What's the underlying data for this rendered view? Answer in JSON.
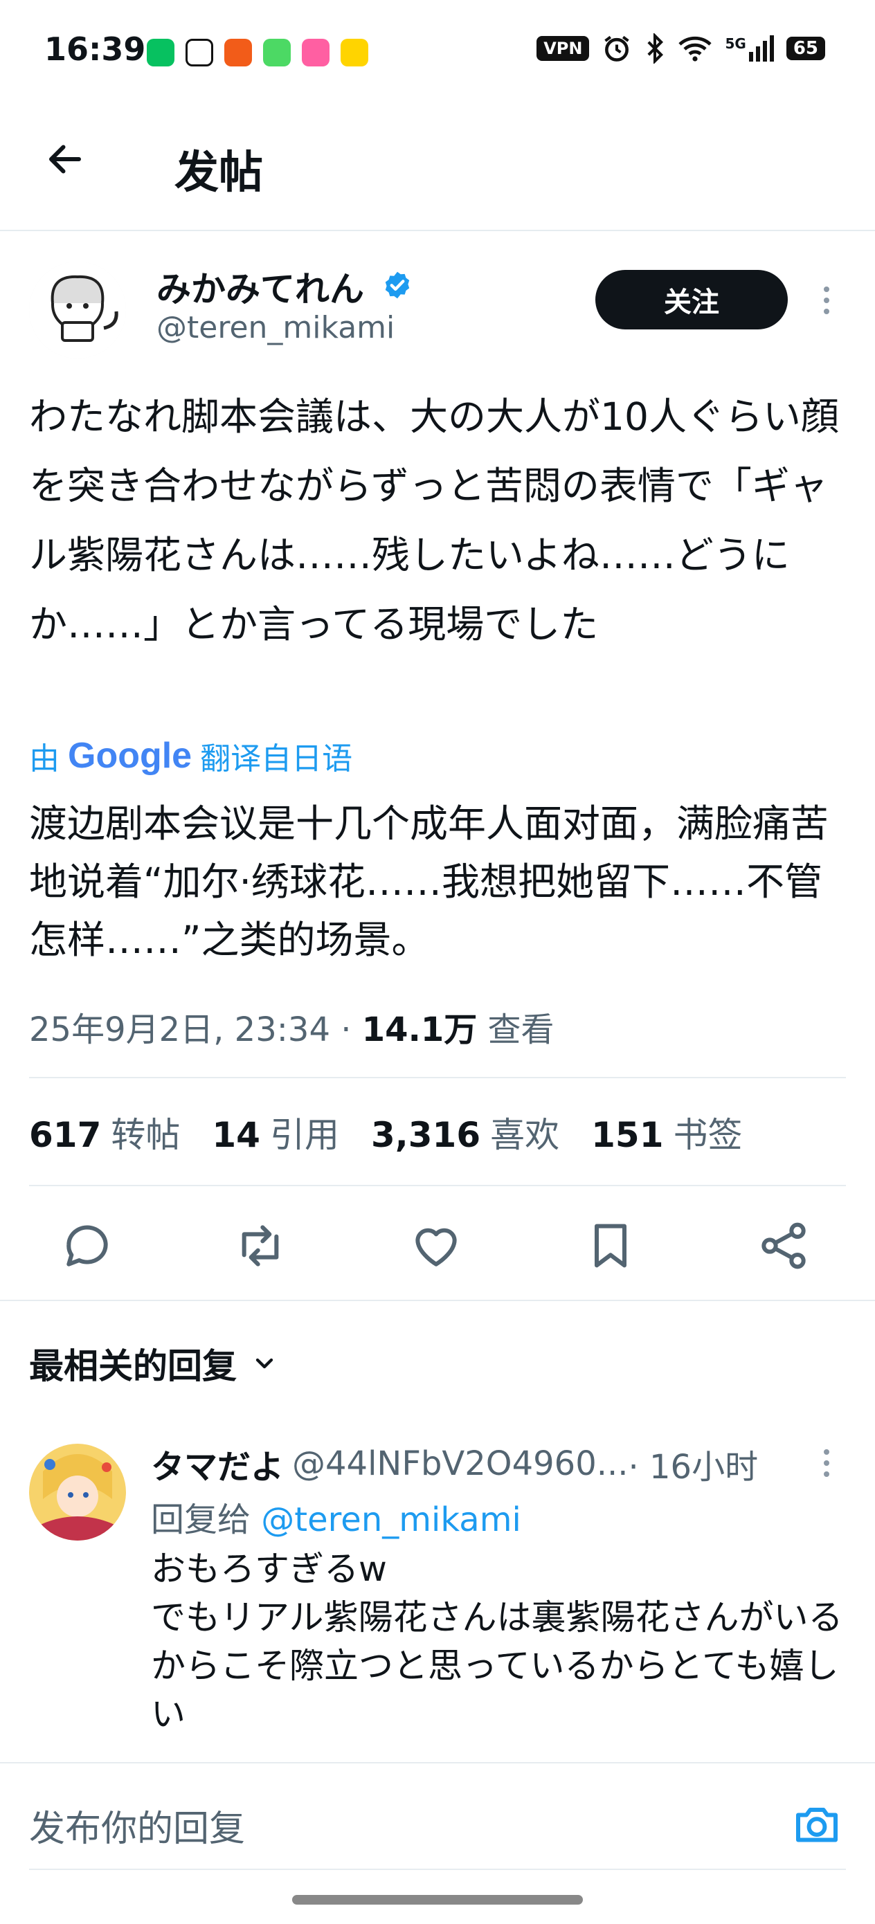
{
  "status_bar": {
    "time": "16:39",
    "vpn": "VPN",
    "network": "5G",
    "battery": "65",
    "notification_apps": [
      "wechat-icon",
      "qq-icon",
      "app-icon",
      "messages-icon",
      "bilibili-icon",
      "app-icon"
    ]
  },
  "header": {
    "title": "发帖"
  },
  "tweet": {
    "author_name": "みかみてれん",
    "author_handle": "@teren_mikami",
    "follow_label": "关注",
    "text": "わたなれ脚本会議は、大の大人が10人ぐらい顔を突き合わせながらずっと苦悶の表情で「ギャル紫陽花さんは……残したいよね……どうにか……」とか言ってる現場でした",
    "translate_prefix": "由",
    "translate_brand": "Google",
    "translate_suffix": "翻译自日语",
    "translated_text": "渡边剧本会议是十几个成年人面对面，满脸痛苦地说着“加尔·绣球花……我想把她留下……不管怎样……”之类的场景。",
    "date": "25年9月2日, 23:34 · ",
    "views": "14.1万",
    "views_label": " 查看"
  },
  "stats": [
    {
      "value": "617",
      "label": "转帖"
    },
    {
      "value": "14",
      "label": "引用"
    },
    {
      "value": "3,316",
      "label": "喜欢"
    },
    {
      "value": "151",
      "label": "书签"
    }
  ],
  "replies_section": {
    "title": "最相关的回复"
  },
  "reply": {
    "name": "タマだよ",
    "handle": "@44lNFbV2O4960...",
    "time": " · 16小时",
    "reply_to_prefix": "回复给 ",
    "reply_to_handle": "@teren_mikami",
    "text": "おもろすぎるw\nでもリアル紫陽花さんは裏紫陽花さんがいるからこそ際立つと思っているからとても嬉しい"
  },
  "composer": {
    "placeholder": "发布你的回复"
  },
  "colors": {
    "accent": "#1d9bf0",
    "text": "#0f1419",
    "muted": "#536471",
    "divider": "#e6ecf0"
  }
}
